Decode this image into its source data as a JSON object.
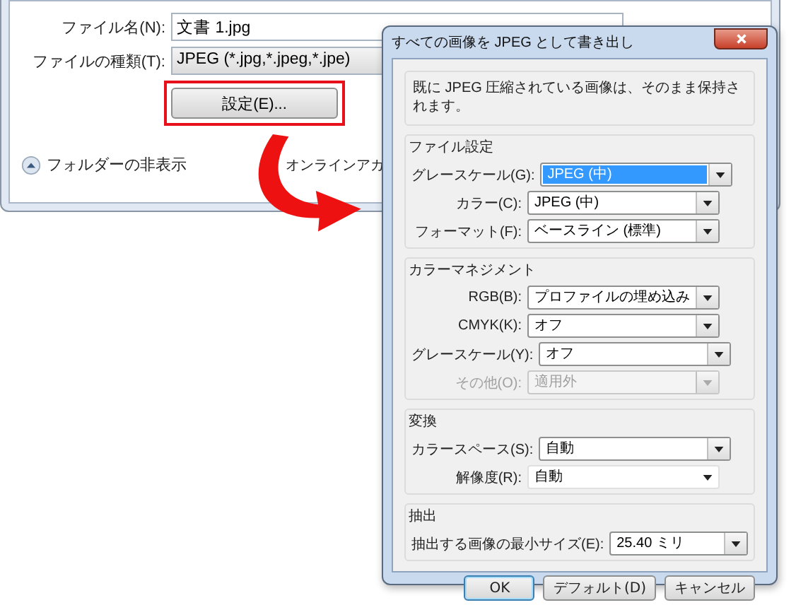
{
  "background_window": {
    "fields": [
      {
        "label": "ファイル名(N):",
        "value": "文書 1.jpg",
        "kind": "text"
      },
      {
        "label": "ファイルの種類(T):",
        "value": "JPEG (*.jpg,*.jpeg,*.jpe)",
        "kind": "select"
      }
    ],
    "settings_button": {
      "label": "設定(E)...",
      "highlighted": true
    },
    "folder_toggle": "フォルダーの非表示",
    "partial_text": "オンラインアカ"
  },
  "dialog": {
    "title": "すべての画像を JPEG として書き出し",
    "note": "既に JPEG 圧縮されている画像は、そのまま保持されます。",
    "groups": [
      {
        "title": "ファイル設定",
        "rows": [
          {
            "label": "グレースケール(G):",
            "value": "JPEG (中)",
            "kind": "select",
            "selected": true,
            "disabled": false
          },
          {
            "label": "カラー(C):",
            "value": "JPEG (中)",
            "kind": "select",
            "selected": false,
            "disabled": false
          },
          {
            "label": "フォーマット(F):",
            "value": "ベースライン (標準)",
            "kind": "select",
            "selected": false,
            "disabled": false
          }
        ]
      },
      {
        "title": "カラーマネジメント",
        "rows": [
          {
            "label": "RGB(B):",
            "value": "プロファイルの埋め込み",
            "kind": "select",
            "selected": false,
            "disabled": false
          },
          {
            "label": "CMYK(K):",
            "value": "オフ",
            "kind": "select",
            "selected": false,
            "disabled": false
          },
          {
            "label": "グレースケール(Y):",
            "value": "オフ",
            "kind": "select",
            "selected": false,
            "disabled": false
          },
          {
            "label": "その他(O):",
            "value": "適用外",
            "kind": "select",
            "selected": false,
            "disabled": true
          }
        ]
      },
      {
        "title": "変換",
        "rows": [
          {
            "label": "カラースペース(S):",
            "value": "自動",
            "kind": "select",
            "selected": false,
            "disabled": false
          },
          {
            "label": "解像度(R):",
            "value": "自動",
            "kind": "combo",
            "selected": false,
            "disabled": false
          }
        ]
      },
      {
        "title": "抽出",
        "rows": [
          {
            "label": "抽出する画像の最小サイズ(E):",
            "value": "25.40 ミリ",
            "kind": "select",
            "selected": false,
            "disabled": false
          }
        ]
      }
    ],
    "buttons": [
      {
        "label": "OK",
        "default": true
      },
      {
        "label": "デフォルト(D)",
        "default": false
      },
      {
        "label": "キャンセル",
        "default": false
      }
    ]
  }
}
